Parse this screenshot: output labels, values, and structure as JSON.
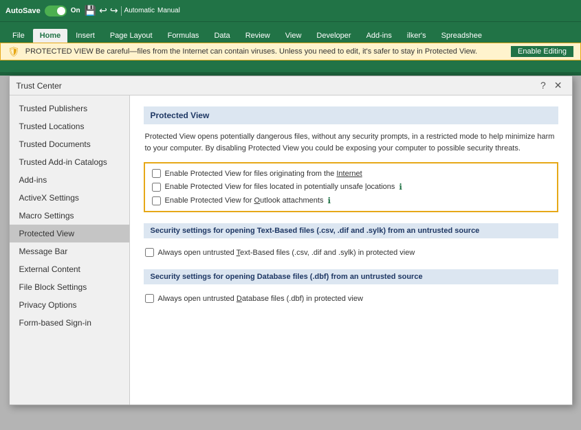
{
  "app": {
    "title": "Trust Center",
    "autosave_label": "AutoSave",
    "toggle_state": "On",
    "protected_view_warning": "PROTECTED VIEW  Be careful—files from the Internet can contain viruses. Unless you need to edit, it's safer to stay in Protected View.",
    "enable_editing_btn": "Enable Editing"
  },
  "ribbon": {
    "tabs": [
      "File",
      "Home",
      "Insert",
      "Page Layout",
      "Formulas",
      "Data",
      "Review",
      "View",
      "Developer",
      "Add-ins",
      "ilker's",
      "Spreadshee"
    ]
  },
  "dialog": {
    "title": "Trust Center",
    "close_btn": "✕",
    "help_btn": "?",
    "minimize_btn": "—"
  },
  "sidebar": {
    "items": [
      {
        "label": "Trusted Publishers",
        "active": false
      },
      {
        "label": "Trusted Locations",
        "active": false
      },
      {
        "label": "Trusted Documents",
        "active": false
      },
      {
        "label": "Trusted Add-in Catalogs",
        "active": false
      },
      {
        "label": "Add-ins",
        "active": false
      },
      {
        "label": "ActiveX Settings",
        "active": false
      },
      {
        "label": "Macro Settings",
        "active": false
      },
      {
        "label": "Protected View",
        "active": true
      },
      {
        "label": "Message Bar",
        "active": false
      },
      {
        "label": "External Content",
        "active": false
      },
      {
        "label": "File Block Settings",
        "active": false
      },
      {
        "label": "Privacy Options",
        "active": false
      },
      {
        "label": "Form-based Sign-in",
        "active": false
      }
    ]
  },
  "main": {
    "section_title": "Protected View",
    "description": "Protected View opens potentially dangerous files, without any security prompts, in a restricted mode to help minimize harm to your computer. By disabling Protected View you could be exposing your computer to possible security threats.",
    "checkboxes": [
      {
        "label": "Enable Protected View for files originating from the Internet",
        "checked": false,
        "underline": "Internet"
      },
      {
        "label": "Enable Protected View for files located in potentially unsafe locations",
        "checked": false,
        "has_info": true,
        "underline": "locations"
      },
      {
        "label": "Enable Protected View for Outlook attachments",
        "checked": false,
        "has_info": true,
        "underline": "Outlook"
      }
    ],
    "text_section_title": "Security settings for opening Text-Based files (.csv, .dif and .sylk) from an untrusted source",
    "text_checkbox": "Always open untrusted Text-Based files (.csv, .dif and .sylk) in protected view",
    "text_checkbox_underline": "Text-Based",
    "db_section_title": "Security settings for opening Database files (.dbf) from an untrusted source",
    "db_checkbox": "Always open untrusted Database files (.dbf) in protected view",
    "db_checkbox_underline": "Database"
  }
}
